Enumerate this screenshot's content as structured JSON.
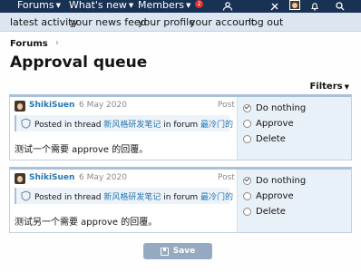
{
  "topnav": {
    "items": [
      "Forums",
      "What's new",
      "Members"
    ],
    "alert_count": "2"
  },
  "subnav": {
    "links": [
      "latest activity",
      "your news feed",
      "your profile",
      "your account",
      "log out"
    ]
  },
  "breadcrumb": {
    "label": "Forums",
    "sep": "›"
  },
  "page": {
    "title": "Approval queue",
    "filters_label": "Filters"
  },
  "items": [
    {
      "user": "ShikiSuen",
      "dot": "·",
      "date": "6 May 2020",
      "type": "Post",
      "context_prefix": "Posted in thread ",
      "thread": "新风格研发笔记",
      "context_mid": " in forum ",
      "forum": "最冷门的「水区」",
      "message": "测试一个需要 approve 的回覆。",
      "options": [
        "Do nothing",
        "Approve",
        "Delete"
      ]
    },
    {
      "user": "ShikiSuen",
      "dot": "·",
      "date": "6 May 2020",
      "type": "Post",
      "context_prefix": "Posted in thread ",
      "thread": "新风格研发笔记",
      "context_mid": " in forum ",
      "forum": "最冷门的「水区」",
      "message": "测试另一个需要 approve 的回覆。",
      "options": [
        "Do nothing",
        "Approve",
        "Delete"
      ]
    }
  ],
  "save_label": "Save",
  "colors": {
    "nav": "#183254",
    "subnav": "#dbe6f1",
    "link": "#2577b1",
    "button": "#95a9c0"
  }
}
